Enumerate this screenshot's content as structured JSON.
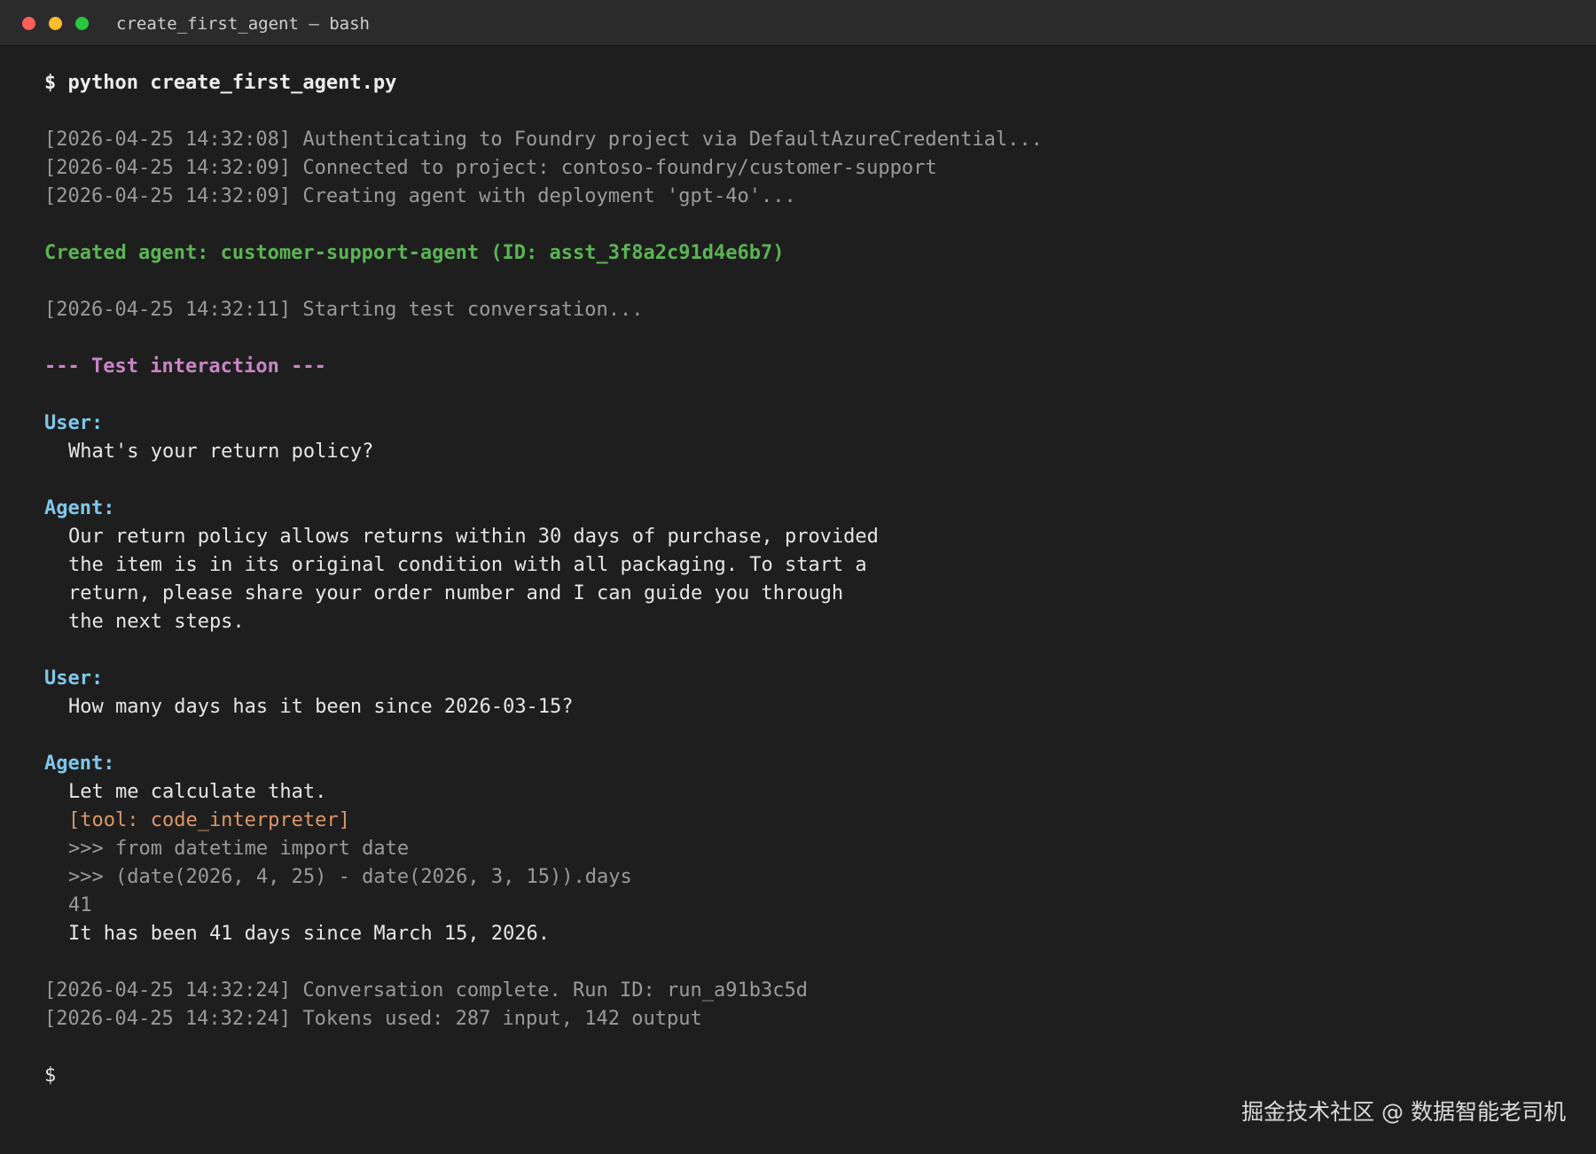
{
  "window": {
    "title": "create_first_agent — bash",
    "traffic_lights": {
      "close_color": "#ff5f57",
      "minimize_color": "#febc2e",
      "maximize_color": "#28c840"
    }
  },
  "colors": {
    "background": "#1e1e1e",
    "titlebar": "#2b2b2b",
    "success": "#5bb454",
    "section_heading": "#c985c6",
    "speaker_label": "#7fc6ea",
    "tool_call": "#dc9766",
    "log": "#9a9a9a"
  },
  "terminal": {
    "command": "$ python create_first_agent.py",
    "logs_start": [
      "[2026-04-25 14:32:08] Authenticating to Foundry project via DefaultAzureCredential...",
      "[2026-04-25 14:32:09] Connected to project: contoso-foundry/customer-support",
      "[2026-04-25 14:32:09] Creating agent with deployment 'gpt-4o'..."
    ],
    "created_agent": "Created agent: customer-support-agent (ID: asst_3f8a2c91d4e6b7)",
    "log_test_start": "[2026-04-25 14:32:11] Starting test conversation...",
    "section_heading": "--- Test interaction ---",
    "conversation": [
      {
        "speaker": "User:",
        "lines": [
          "What's your return policy?"
        ]
      },
      {
        "speaker": "Agent:",
        "lines": [
          "Our return policy allows returns within 30 days of purchase, provided",
          "the item is in its original condition with all packaging. To start a",
          "return, please share your order number and I can guide you through",
          "the next steps."
        ]
      },
      {
        "speaker": "User:",
        "lines": [
          "How many days has it been since 2026-03-15?"
        ]
      },
      {
        "speaker": "Agent:",
        "intro": "Let me calculate that.",
        "tool_call": "[tool: code_interpreter]",
        "code_lines": [
          ">>> from datetime import date",
          ">>> (date(2026, 4, 25) - date(2026, 3, 15)).days",
          "41"
        ],
        "answer": "It has been 41 days since March 15, 2026."
      }
    ],
    "logs_end": [
      "[2026-04-25 14:32:24] Conversation complete. Run ID: run_a91b3c5d",
      "[2026-04-25 14:32:24] Tokens used: 287 input, 142 output"
    ],
    "prompt": "$"
  },
  "watermark": "掘金技术社区 @ 数据智能老司机"
}
